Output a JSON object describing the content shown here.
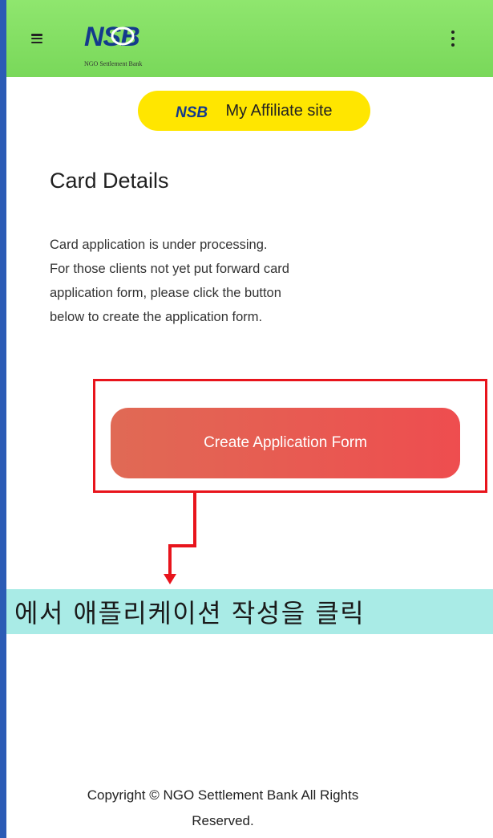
{
  "topbar": {
    "logo_text": "NSB",
    "logo_subtitle": "NGO Settlement Bank",
    "menu_icon": "hamburger-menu-icon",
    "more_icon": "kebab-more-icon",
    "background_color": "#7ddc5e"
  },
  "affiliate": {
    "logo_text": "NSB",
    "label": "My Affiliate site",
    "background_color": "#ffe600"
  },
  "card": {
    "title": "Card Details",
    "description_lines": [
      "Card application is under processing.",
      "For those clients not yet put forward card",
      "application form, please click the button",
      "below to create the application form."
    ]
  },
  "create_button": {
    "label": "Create Application Form",
    "color": "#e95a52"
  },
  "annotation": {
    "text": "에서 애플리케이션 작성을 클릭",
    "highlight_color": "#e8141c",
    "banner_color": "#a9ebe6"
  },
  "footer": {
    "line1": "Copyright © NGO Settlement Bank All Rights",
    "line2": "Reserved."
  }
}
